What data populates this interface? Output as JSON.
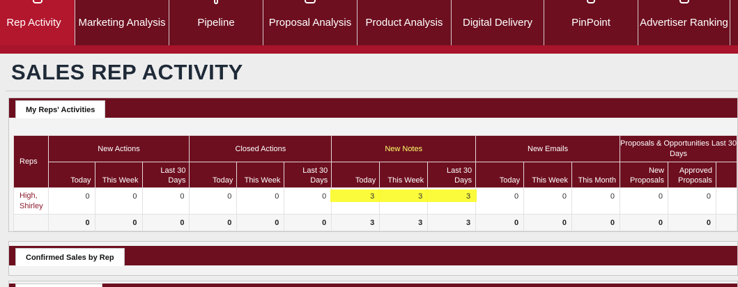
{
  "nav": {
    "items": [
      {
        "label": "Rep Activity",
        "active": true
      },
      {
        "label": "Marketing Analysis",
        "active": false
      },
      {
        "label": "Pipeline",
        "active": false
      },
      {
        "label": "Proposal Analysis",
        "active": false
      },
      {
        "label": "Product Analysis",
        "active": false
      },
      {
        "label": "Digital Delivery",
        "active": false
      },
      {
        "label": "PinPoint",
        "active": false
      },
      {
        "label": "Advertiser Ranking",
        "active": false
      }
    ]
  },
  "page": {
    "title": "SALES REP ACTIVITY"
  },
  "panels": {
    "reps_activities": {
      "tab_label": "My Reps' Activities"
    },
    "confirmed_sales": {
      "tab_label": "Confirmed Sales by Rep"
    }
  },
  "table": {
    "reps_header": "Reps",
    "groups": {
      "new_actions": "New Actions",
      "closed_actions": "Closed Actions",
      "new_notes": "New Notes",
      "new_emails": "New Emails",
      "proposals": "Proposals & Opportunities Last 30 Days"
    },
    "sub": {
      "today": "Today",
      "this_week": "This Week",
      "last_30_days": "Last 30 Days",
      "this_month": "This Month",
      "new_proposals": "New Proposals",
      "approved_proposals": "Approved Proposals"
    },
    "row": {
      "rep": "High, Shirley",
      "values": [
        "0",
        "0",
        "0",
        "0",
        "0",
        "0",
        "3",
        "3",
        "3",
        "0",
        "0",
        "0",
        "0",
        "0"
      ]
    },
    "totals": [
      "0",
      "0",
      "0",
      "0",
      "0",
      "0",
      "3",
      "3",
      "3",
      "0",
      "0",
      "0",
      "0",
      "0"
    ]
  },
  "colors": {
    "nav_bg": "#6d0f1f",
    "nav_active": "#b3172d",
    "highlight": "#fbfb2a"
  }
}
